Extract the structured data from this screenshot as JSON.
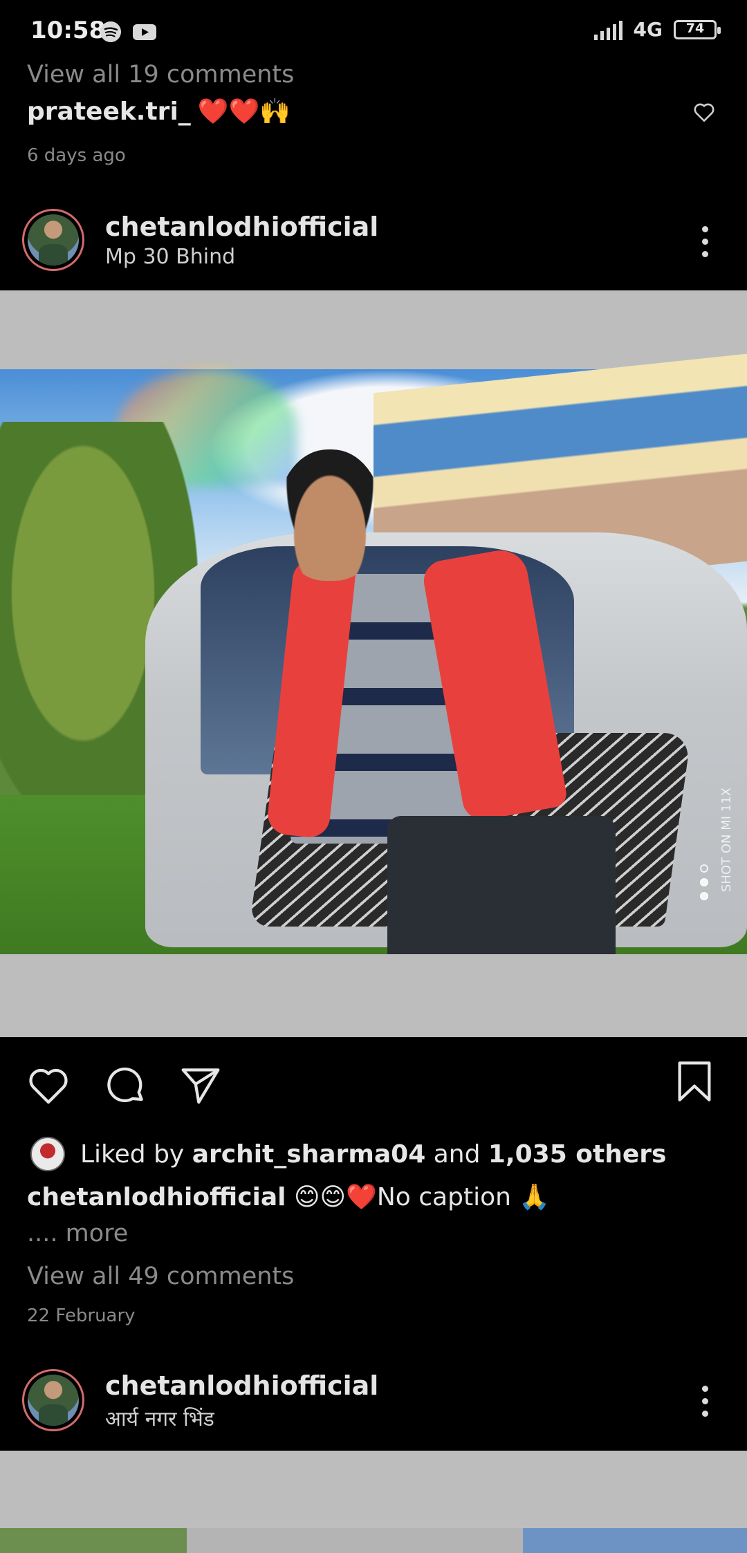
{
  "status_bar": {
    "time": "10:58",
    "app_icons": [
      "spotify-icon",
      "youtube-icon"
    ],
    "network": "4G",
    "battery": "74"
  },
  "previous_post": {
    "view_comments": "View all 19 comments",
    "comment_user": "prateek.tri_",
    "comment_emojis": "❤️❤️🙌",
    "time_ago": "6 days ago"
  },
  "post": {
    "username": "chetanlodhiofficial",
    "location": "Mp 30 Bhind",
    "image_watermark": "SHOT ON MI 11X",
    "liked_by_prefix": "Liked by",
    "liked_by_user": "archit_sharma04",
    "liked_by_and": "and",
    "liked_by_others": "1,035 others",
    "caption_user": "chetanlodhiofficial",
    "caption_text": "😊😊❤️No caption 🙏",
    "more": ".... more",
    "view_comments": "View all 49 comments",
    "date": "22 February"
  },
  "next_post": {
    "username": "chetanlodhiofficial",
    "location": "आर्य नगर भिंड"
  }
}
